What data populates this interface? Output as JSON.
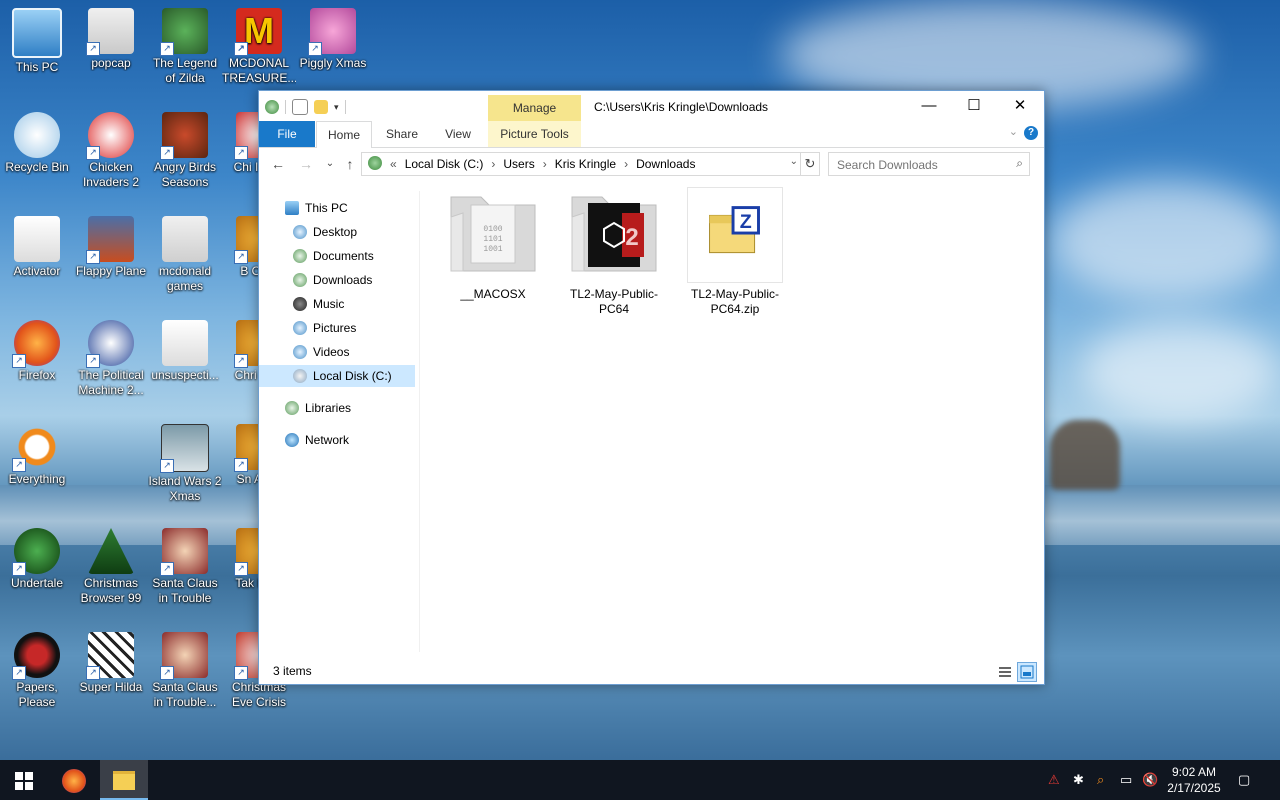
{
  "desktop_icons": [
    {
      "label": "This PC"
    },
    {
      "label": "popcap"
    },
    {
      "label": "The Legend of Zilda"
    },
    {
      "label": "MCDONAL TREASURE..."
    },
    {
      "label": "Piggly Xmas"
    },
    {
      "label": "Recycle Bin"
    },
    {
      "label": "Chicken Invaders 2"
    },
    {
      "label": "Angry Birds Seasons"
    },
    {
      "label": "Chi Invad"
    },
    {
      "label": "Activator"
    },
    {
      "label": "Flappy Plane"
    },
    {
      "label": "mcdonald games"
    },
    {
      "label": "B Oma"
    },
    {
      "label": "Firefox"
    },
    {
      "label": "The Political Machine 2..."
    },
    {
      "label": "unsuspecti..."
    },
    {
      "label": "Chri Swe"
    },
    {
      "label": "Everything"
    },
    {
      "label": "Island Wars 2 Xmas"
    },
    {
      "label": "Sn Anim"
    },
    {
      "label": "Undertale"
    },
    {
      "label": "Christmas Browser 99"
    },
    {
      "label": "Santa Claus in Trouble"
    },
    {
      "label": "Tak Brea"
    },
    {
      "label": "Papers, Please"
    },
    {
      "label": "Super Hilda"
    },
    {
      "label": "Santa Claus in Trouble..."
    },
    {
      "label": "Christmas Eve Crisis"
    }
  ],
  "window": {
    "title_path": "C:\\Users\\Kris Kringle\\Downloads",
    "manage_label": "Manage",
    "tabs": {
      "file": "File",
      "home": "Home",
      "share": "Share",
      "view": "View",
      "picture_tools": "Picture Tools"
    },
    "help_label": "?",
    "address": {
      "prefix": "«",
      "crumbs": [
        "Local Disk (C:)",
        "Users",
        "Kris Kringle",
        "Downloads"
      ],
      "separator": "›"
    },
    "search_placeholder": "Search Downloads",
    "nav": {
      "this_pc": "This PC",
      "desktop": "Desktop",
      "documents": "Documents",
      "downloads": "Downloads",
      "music": "Music",
      "pictures": "Pictures",
      "videos": "Videos",
      "local_disk": "Local Disk (C:)",
      "libraries": "Libraries",
      "network": "Network"
    },
    "files": [
      {
        "name": "__MACOSX",
        "kind": "folder"
      },
      {
        "name": "TL2-May-Public-PC64",
        "kind": "folder"
      },
      {
        "name": "TL2-May-Public-PC64.zip",
        "kind": "zip"
      }
    ],
    "status_count": "3 items"
  },
  "taskbar": {
    "time": "9:02 AM",
    "date": "2/17/2025"
  },
  "colors": {
    "accent": "#1979ca",
    "manage_tab": "#f6e58d",
    "selection": "#cce8ff"
  }
}
